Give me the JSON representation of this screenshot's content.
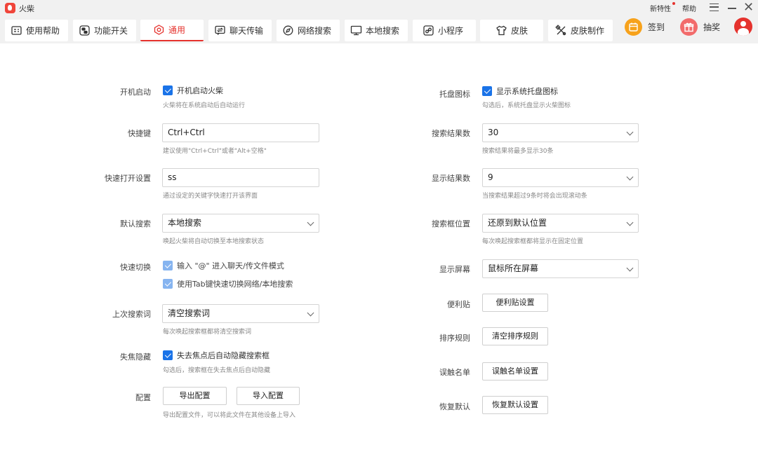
{
  "app": {
    "title": "火柴"
  },
  "titlebar": {
    "new_features": "新特性",
    "help": "帮助"
  },
  "tabs": [
    {
      "label": "使用帮助",
      "icon": "help-doc-icon"
    },
    {
      "label": "功能开关",
      "icon": "toggle-icon"
    },
    {
      "label": "通用",
      "icon": "general-settings-icon",
      "active": true
    },
    {
      "label": "聊天传输",
      "icon": "chat-transfer-icon"
    },
    {
      "label": "网络搜索",
      "icon": "web-search-icon"
    },
    {
      "label": "本地搜索",
      "icon": "local-search-icon"
    },
    {
      "label": "小程序",
      "icon": "mini-program-icon"
    },
    {
      "label": "皮肤",
      "icon": "skin-icon"
    },
    {
      "label": "皮肤制作",
      "icon": "skin-make-icon"
    }
  ],
  "actions": {
    "checkin": "签到",
    "lottery": "抽奖"
  },
  "colors": {
    "accent": "#e5322d",
    "checkbox": "#1a73e8",
    "titlebar_bg": "#f1f1f1"
  },
  "left": {
    "autostart": {
      "label": "开机启动",
      "checkbox": "开机启动火柴",
      "checked": true,
      "hint": "火柴将在系统启动后自动运行"
    },
    "hotkey": {
      "label": "快捷键",
      "value": "Ctrl+Ctrl",
      "hint": "建议使用\"Ctrl+Ctrl\"或者\"Alt+空格\""
    },
    "quickopen": {
      "label": "快速打开设置",
      "value": "ss",
      "hint": "通过设定的关键字快速打开该界面"
    },
    "default_search": {
      "label": "默认搜索",
      "value": "本地搜索",
      "hint": "唤起火柴将自动切换至本地搜索状态"
    },
    "quick_switch": {
      "label": "快速切换",
      "option1": "输入 \"@\" 进入聊天/传文件模式",
      "option2": "使用Tab键快速切换网络/本地搜索",
      "checked1": true,
      "checked2": true
    },
    "last_term": {
      "label": "上次搜索词",
      "value": "清空搜索词",
      "hint": "每次唤起搜索框都将清空搜索词"
    },
    "blur_hide": {
      "label": "失焦隐藏",
      "checkbox": "失去焦点后自动隐藏搜索框",
      "checked": true,
      "hint": "勾选后，搜索框在失去焦点后自动隐藏"
    },
    "config": {
      "label": "配置",
      "export": "导出配置",
      "import": "导入配置",
      "hint": "导出配置文件，可以将此文件在其他设备上导入"
    }
  },
  "right": {
    "tray": {
      "label": "托盘图标",
      "checkbox": "显示系统托盘图标",
      "checked": true,
      "hint": "勾选后，系统托盘显示火柴图标"
    },
    "result_count": {
      "label": "搜索结果数",
      "value": "30",
      "hint": "搜索结果将最多显示30条"
    },
    "display_count": {
      "label": "显示结果数",
      "value": "9",
      "hint": "当搜索结果超过9条时将会出现滚动条"
    },
    "box_position": {
      "label": "搜索框位置",
      "value": "还原到默认位置",
      "hint": "每次唤起搜索框都将显示在固定位置"
    },
    "screen": {
      "label": "显示屏幕",
      "value": "鼠标所在屏幕"
    },
    "sticky": {
      "label": "便利贴",
      "button": "便利贴设置"
    },
    "sort": {
      "label": "排序规则",
      "button": "清空排序规则"
    },
    "mistouch": {
      "label": "误触名单",
      "button": "误触名单设置"
    },
    "restore": {
      "label": "恢复默认",
      "button": "恢复默认设置"
    }
  }
}
